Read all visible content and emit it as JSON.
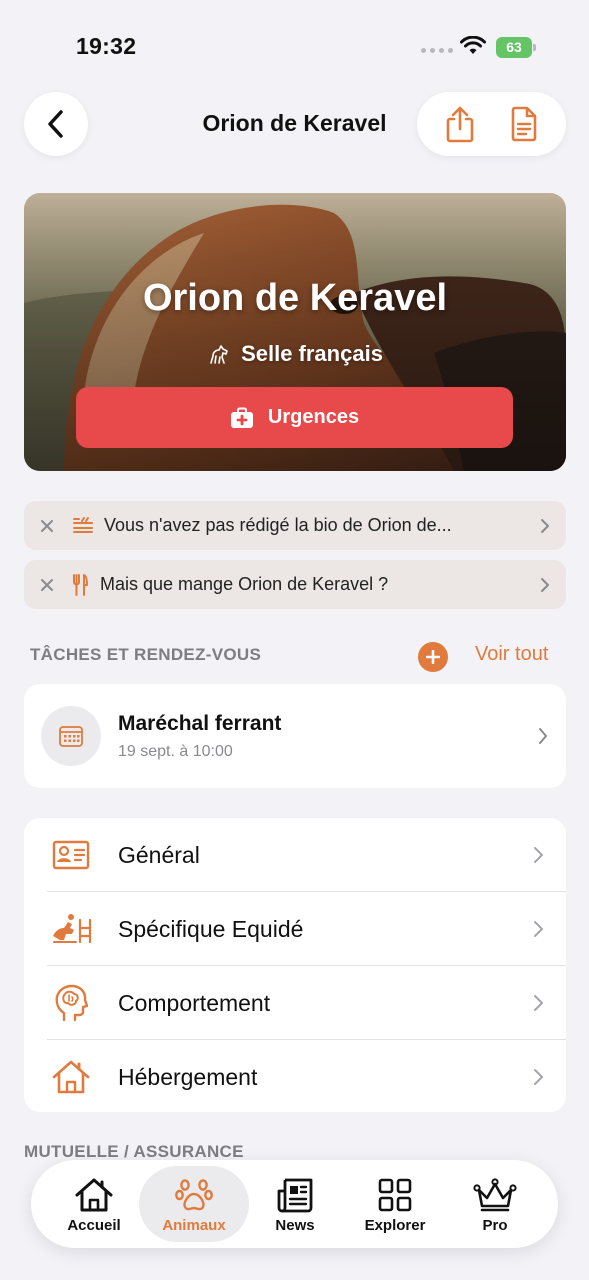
{
  "status_bar": {
    "time": "19:32",
    "battery": "63"
  },
  "nav": {
    "title": "Orion de Keravel"
  },
  "hero": {
    "name": "Orion de Keravel",
    "breed": "Selle français",
    "urgences_label": "Urgences"
  },
  "tips": [
    {
      "text": "Vous n'avez pas rédigé la bio de Orion de..."
    },
    {
      "text": "Mais que mange Orion de Keravel ?"
    }
  ],
  "tasks_section": {
    "label": "TÂCHES ET RENDEZ-VOUS",
    "see_all": "Voir tout"
  },
  "task": {
    "title": "Maréchal ferrant",
    "date": "19 sept. à 10:00"
  },
  "menu": [
    {
      "label": "Général",
      "icon": "id-card-icon"
    },
    {
      "label": "Spécifique Equidé",
      "icon": "horse-jumping-icon"
    },
    {
      "label": "Comportement",
      "icon": "brain-head-icon"
    },
    {
      "label": "Hébergement",
      "icon": "house-icon"
    }
  ],
  "section2": {
    "label": "MUTUELLE / ASSURANCE"
  },
  "tabbar": {
    "items": [
      {
        "label": "Accueil"
      },
      {
        "label": "Animaux"
      },
      {
        "label": "News"
      },
      {
        "label": "Explorer"
      },
      {
        "label": "Pro"
      }
    ]
  },
  "colors": {
    "accent": "#e07b3d",
    "urgent": "#e8494a",
    "background": "#f2f2f7",
    "tip_bg": "#ece6e4"
  }
}
